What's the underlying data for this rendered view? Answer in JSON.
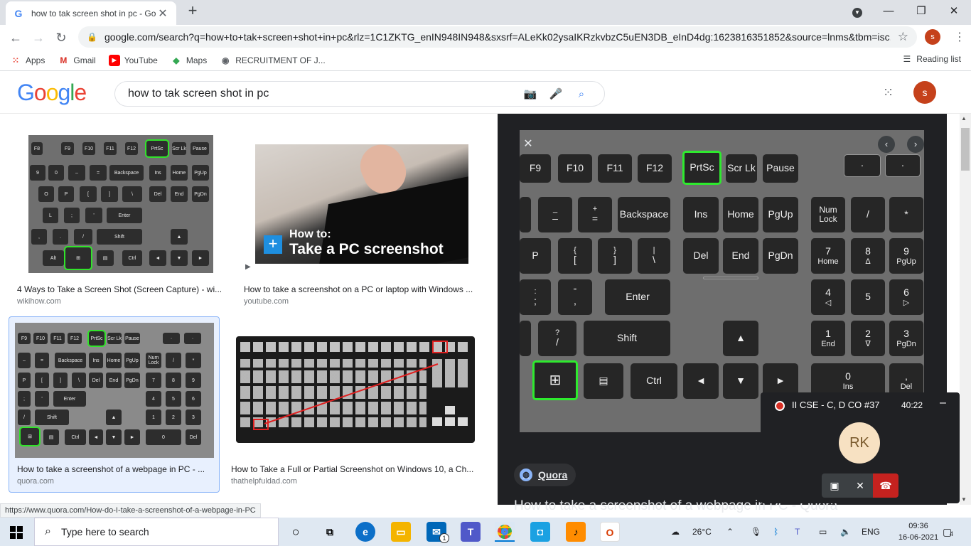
{
  "browser": {
    "tab_title": "how to tak screen shot in pc - Go",
    "url": "google.com/search?q=how+to+tak+screen+shot+in+pc&rlz=1C1ZKTG_enIN948IN948&sxsrf=ALeKk02ysaIKRzkvbzC5uEN3DB_eInD4dg:1623816351852&source=lnms&tbm=isc...",
    "profile_initial": "s",
    "bookmarks": [
      "Apps",
      "Gmail",
      "YouTube",
      "Maps",
      "RECRUITMENT OF J..."
    ],
    "reading_list": "Reading list"
  },
  "google": {
    "logo": "Google",
    "query": "how to tak screen shot in pc",
    "profile_initial": "s"
  },
  "results": [
    {
      "title": "4 Ways to Take a Screen Shot (Screen Capture) - wi...",
      "source": "wikihow.com"
    },
    {
      "title": "How to take a screenshot on a PC or laptop with Windows ...",
      "source": "youtube.com",
      "overlay_line1": "How to:",
      "overlay_line2": "Take a PC screenshot"
    },
    {
      "title": "How to take a screenshot of a webpage in PC - ...",
      "source": "quora.com"
    },
    {
      "title": "How to Take a Full or Partial Screenshot on Windows 10, a Ch...",
      "source": "thathelpfuldad.com"
    }
  ],
  "preview": {
    "source": "Quora",
    "title": "How to take a screenshot of a webpage in PC - Quora",
    "keys": {
      "f9": "F9",
      "f10": "F10",
      "f11": "F11",
      "f12": "F12",
      "prtsc": "PrtSc",
      "scrlk": "Scr Lk",
      "pause": "Pause",
      "minus_top": "_",
      "minus": "–",
      "plus_top": "+",
      "equals": "=",
      "backspace": "Backspace",
      "ins": "Ins",
      "home": "Home",
      "pgup": "PgUp",
      "numlock": "Num Lock",
      "slash": "/",
      "star": "*",
      "p": "P",
      "lbr_top": "{",
      "lbr": "[",
      "rbr_top": "}",
      "rbr": "]",
      "bsl_top": "|",
      "bsl": "\\",
      "del": "Del",
      "end": "End",
      "pgdn": "PgDn",
      "n7": "7",
      "n7s": "Home",
      "n8": "8",
      "n8s": "Δ",
      "n9": "9",
      "n9s": "PgUp",
      "semi_top": ":",
      "semi": ";",
      "quote_top": "\"",
      "quote": ",",
      "enter": "Enter",
      "n4": "4",
      "n4s": "◁",
      "n5": "5",
      "n6": "6",
      "n6s": "▷",
      "q_top": "?",
      "q": "/",
      "shift": "Shift",
      "up": "▲",
      "n1": "1",
      "n1s": "End",
      "n2": "2",
      "n2s": "∇",
      "n3": "3",
      "n3s": "PgDn",
      "win": "⊞",
      "menu": "▤",
      "ctrl": "Ctrl",
      "left": "◄",
      "down": "▼",
      "right": "►",
      "n0": "0",
      "n0s": "Ins",
      "ndot": ",",
      "ndots": "Del"
    }
  },
  "status_url": "https://www.quora.com/How-do-I-take-a-screenshot-of-a-webpage-in-PC",
  "meet": {
    "title": "II CSE - C, D CO #37",
    "time": "40:22",
    "avatar": "RK"
  },
  "taskbar": {
    "search_placeholder": "Type here to search",
    "mail_badge": "1",
    "temperature": "26°C",
    "language": "ENG",
    "time": "09:36",
    "date": "16-06-2021",
    "notifications": "4"
  }
}
